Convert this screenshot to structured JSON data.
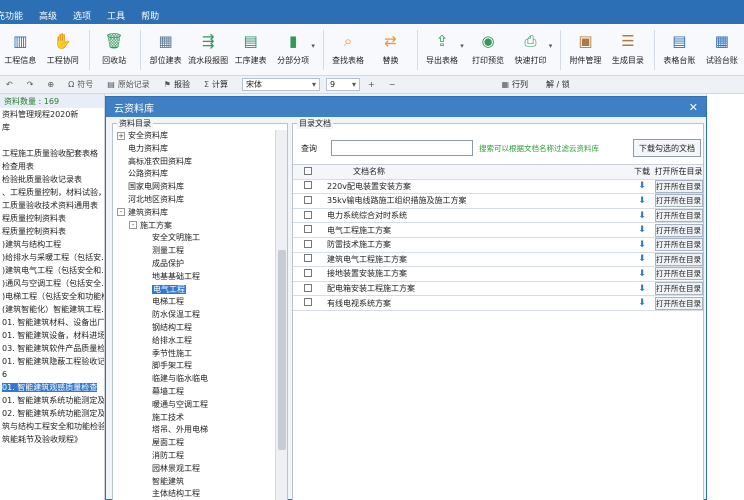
{
  "menubar": {
    "items": [
      "充功能",
      "高级",
      "选项",
      "工具",
      "帮助"
    ]
  },
  "ribbon": {
    "items": [
      {
        "label": "工程信息",
        "icon": "building-icon",
        "color": "#2f6fb3"
      },
      {
        "label": "工程协同",
        "icon": "handshake-icon",
        "color": "#3a7fd0"
      },
      {
        "label": "回收站",
        "icon": "trash-icon",
        "color": "#2f9a5a"
      },
      {
        "label": "部位建表",
        "icon": "grid-icon",
        "color": "#5c7b95"
      },
      {
        "label": "流水段报图",
        "icon": "flow-icon",
        "color": "#2f9a5a"
      },
      {
        "label": "工序建表",
        "icon": "sheet-icon",
        "color": "#2f8f6a"
      },
      {
        "label": "分部分项",
        "icon": "chart-icon",
        "color": "#2f9a5a"
      },
      {
        "label": "查找表格",
        "icon": "search-icon",
        "color": "#f0952b"
      },
      {
        "label": "替换",
        "icon": "replace-icon",
        "color": "#f0952b"
      },
      {
        "label": "导出表格",
        "icon": "export-icon",
        "color": "#2f9a5a"
      },
      {
        "label": "打印预览",
        "icon": "eye-icon",
        "color": "#2f9a5a"
      },
      {
        "label": "快速打印",
        "icon": "printer-icon",
        "color": "#2f9a5a"
      },
      {
        "label": "附件管理",
        "icon": "attachment-icon",
        "color": "#b07a3a"
      },
      {
        "label": "生成目录",
        "icon": "catalog-icon",
        "color": "#b07a3a"
      },
      {
        "label": "表格台账",
        "icon": "ledger-icon",
        "color": "#2f6fb3"
      },
      {
        "label": "试验台账",
        "icon": "test-ledger-icon",
        "color": "#2f6fb3"
      }
    ]
  },
  "fmtbar": {
    "symbol": "符号",
    "origin_record": "原始记录",
    "report": "报验",
    "calc": "计算",
    "font": "宋体",
    "font_size": "9",
    "row": "行列",
    "unlock": "解 / 锁"
  },
  "leftpanel": {
    "status": "资料数量 : 169",
    "items": [
      "资料管理规程2020新",
      "库",
      "",
      "工程施工质量验收配套表格",
      "检查用表",
      "检验批质量验收记录表",
      "、工程质量控制，材料试验，...",
      "工质量验收技术资料通用表",
      "程质量控制资料表",
      "程质量控制资料表",
      ")建筑与结构工程",
      ")给排水与采暖工程（包括安...",
      ")建筑电气工程（包括安全和...",
      ")通风与空调工程（包括安全...",
      ")电梯工程（包括安全和功能检...",
      "(建筑智能化）智能建筑工程...",
      "01. 智能建筑材料、设备出厂...",
      "01. 智能建筑设备，材料进场...",
      "03. 智能建筑软件产品质量检...",
      "01. 智能建筑隐蔽工程验收记...",
      "6",
      "01. 智能建筑观感质量检查",
      "01. 智能建筑系统功能测定及...",
      "02. 智能建筑系统功能测定及...",
      "筑与结构工程安全和功能检验...",
      "筑能耗节及验收规程》"
    ]
  },
  "modal": {
    "title": "云资料库",
    "close": "✕",
    "tree_caption": "资料目录",
    "docs_caption": "目录文档",
    "tree": [
      {
        "label": "安全资料库",
        "level": 0,
        "toggle": "+"
      },
      {
        "label": "电力资料库",
        "level": 0,
        "toggle": ""
      },
      {
        "label": "高标准农田资料库",
        "level": 0,
        "toggle": ""
      },
      {
        "label": "公路资料库",
        "level": 0,
        "toggle": ""
      },
      {
        "label": "国家电网资料库",
        "level": 0,
        "toggle": ""
      },
      {
        "label": "河北地区资料库",
        "level": 0,
        "toggle": ""
      },
      {
        "label": "建筑资料库",
        "level": 0,
        "toggle": "-"
      },
      {
        "label": "施工方案",
        "level": 1,
        "toggle": "-"
      },
      {
        "label": "安全文明施工",
        "level": 2,
        "toggle": ""
      },
      {
        "label": "测量工程",
        "level": 2,
        "toggle": ""
      },
      {
        "label": "成品保护",
        "level": 2,
        "toggle": ""
      },
      {
        "label": "地基基础工程",
        "level": 2,
        "toggle": ""
      },
      {
        "label": "电气工程",
        "level": 2,
        "toggle": "",
        "selected": true
      },
      {
        "label": "电梯工程",
        "level": 2,
        "toggle": ""
      },
      {
        "label": "防水保温工程",
        "level": 2,
        "toggle": ""
      },
      {
        "label": "钢结构工程",
        "level": 2,
        "toggle": ""
      },
      {
        "label": "给排水工程",
        "level": 2,
        "toggle": ""
      },
      {
        "label": "季节性施工",
        "level": 2,
        "toggle": ""
      },
      {
        "label": "脚手架工程",
        "level": 2,
        "toggle": ""
      },
      {
        "label": "临建与临水临电",
        "level": 2,
        "toggle": ""
      },
      {
        "label": "幕墙工程",
        "level": 2,
        "toggle": ""
      },
      {
        "label": "暖通与空调工程",
        "level": 2,
        "toggle": ""
      },
      {
        "label": "施工技术",
        "level": 2,
        "toggle": ""
      },
      {
        "label": "塔吊、外用电梯",
        "level": 2,
        "toggle": ""
      },
      {
        "label": "屋面工程",
        "level": 2,
        "toggle": ""
      },
      {
        "label": "消防工程",
        "level": 2,
        "toggle": ""
      },
      {
        "label": "园林景观工程",
        "level": 2,
        "toggle": ""
      },
      {
        "label": "智能建筑",
        "level": 2,
        "toggle": ""
      },
      {
        "label": "主体结构工程",
        "level": 2,
        "toggle": ""
      }
    ],
    "query": {
      "label": "查询",
      "value": "",
      "hint": "搜索可以根据文档名称过滤云资料库",
      "download_button": "下载勾选的文档"
    },
    "grid": {
      "headers": {
        "name": "文档名称",
        "download": "下载",
        "open": "打开所在目录"
      },
      "open_label": "打开所在目录",
      "rows": [
        "220v配电装置安装方案",
        "35kv输电线路施工组织措施及施工方案",
        "电力系统综合对时系统",
        "电气工程施工方案",
        "防雷技术施工方案",
        "建筑电气工程施工方案",
        "接地装置安装施工方案",
        "配电箱安装工程施工方案",
        "有线电视系统方案"
      ]
    }
  }
}
